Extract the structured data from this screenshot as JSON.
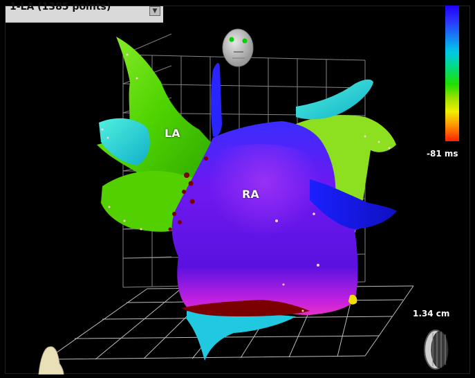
{
  "map_selector": {
    "value": "1-LA (1385 points)"
  },
  "colors": {
    "background": "#000000",
    "ra_surface": "#6a1cf0",
    "la_surface": "#7fe000",
    "scar": "#7a0000",
    "grid": "#bfbfbf"
  },
  "colorbar": {
    "bottom_label": "-81 ms"
  },
  "scale": {
    "label": "1.34 cm"
  },
  "chamber_labels": {
    "la": "LA",
    "ra": "RA"
  },
  "icons": {
    "orientation_head": "head-orientation-icon",
    "orientation_torso": "torso-orientation-icon",
    "scale_coin": "scale-coin-icon",
    "dropdown": "chevron-down-icon"
  }
}
